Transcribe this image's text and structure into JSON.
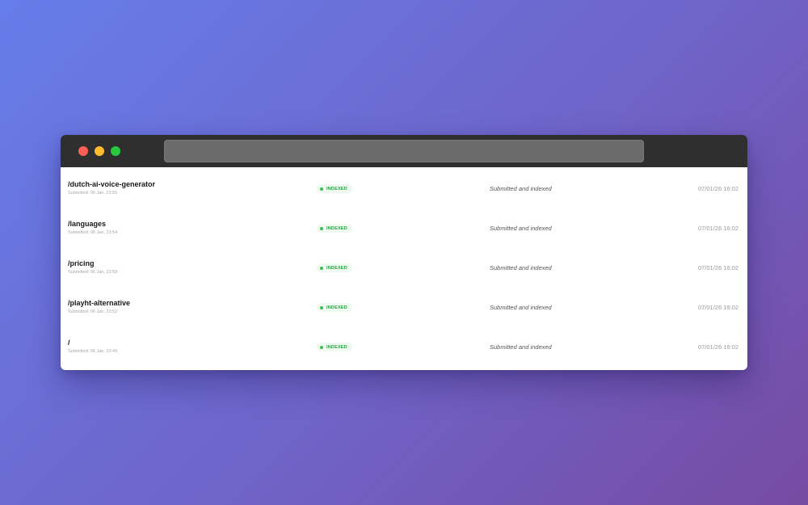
{
  "window": {
    "controls": [
      "close",
      "minimize",
      "maximize"
    ],
    "address_bar": {
      "value": ""
    }
  },
  "colors": {
    "background_gradient": [
      "#667eea",
      "#764ba2"
    ],
    "titlebar": "#2f2f2f",
    "close": "#ff5f57",
    "minimize": "#febc2e",
    "maximize": "#28c840",
    "indexed_badge_bg": "#eef9ef",
    "indexed_badge_text": "#2f9e47"
  },
  "pages": [
    {
      "path": "/dutch-ai-voice-generator",
      "submitted": "Submitted: 06 Jan, 23:55",
      "badge": "INDEXED",
      "status": "Submitted and indexed",
      "last_checked": "07/01/26 16:02"
    },
    {
      "path": "/languages",
      "submitted": "Submitted: 06 Jan, 23:54",
      "badge": "INDEXED",
      "status": "Submitted and indexed",
      "last_checked": "07/01/26 16:02"
    },
    {
      "path": "/pricing",
      "submitted": "Submitted: 06 Jan, 23:58",
      "badge": "INDEXED",
      "status": "Submitted and indexed",
      "last_checked": "07/01/26 16:02"
    },
    {
      "path": "/playht-alternative",
      "submitted": "Submitted: 06 Jan, 23:52",
      "badge": "INDEXED",
      "status": "Submitted and indexed",
      "last_checked": "07/01/26 16:02"
    },
    {
      "path": "/",
      "submitted": "Submitted: 06 Jan, 23:49",
      "badge": "INDEXED",
      "status": "Submitted and indexed",
      "last_checked": "07/01/26 16:02"
    }
  ]
}
